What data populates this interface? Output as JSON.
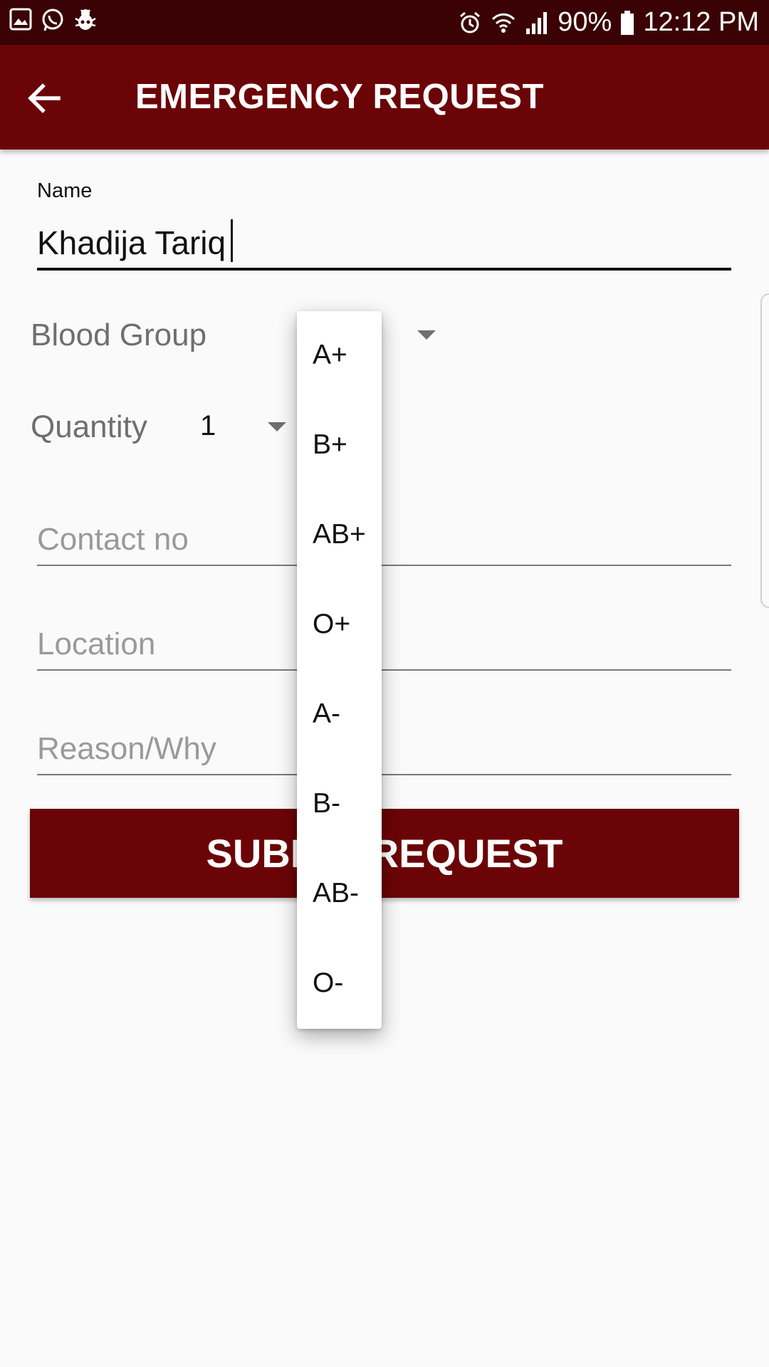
{
  "status_bar": {
    "battery": "90%",
    "time": "12:12 PM",
    "left_icons": [
      "gallery-icon",
      "whatsapp-icon",
      "bug-icon"
    ],
    "right_icons": [
      "alarm-icon",
      "wifi-icon",
      "signal-icon",
      "battery-icon"
    ]
  },
  "app_bar": {
    "title": "EMERGENCY REQUEST",
    "back_icon": "arrow-back-icon",
    "background": "#6b0406"
  },
  "form": {
    "name_label": "Name",
    "name_value": "Khadija Tariq",
    "blood_group_label": "Blood Group",
    "quantity_label": "Quantity",
    "quantity_value": "1",
    "contact_placeholder": "Contact no",
    "location_placeholder": "Location",
    "reason_placeholder": "Reason/Why",
    "submit_label": "SUBMIT REQUEST"
  },
  "blood_group_dropdown": {
    "items": [
      "A+",
      "B+",
      "AB+",
      "O+",
      "A-",
      "B-",
      "AB-",
      "O-"
    ]
  },
  "colors": {
    "status_bar": "#3a0204",
    "primary": "#6b0406",
    "background": "#fafafa"
  }
}
